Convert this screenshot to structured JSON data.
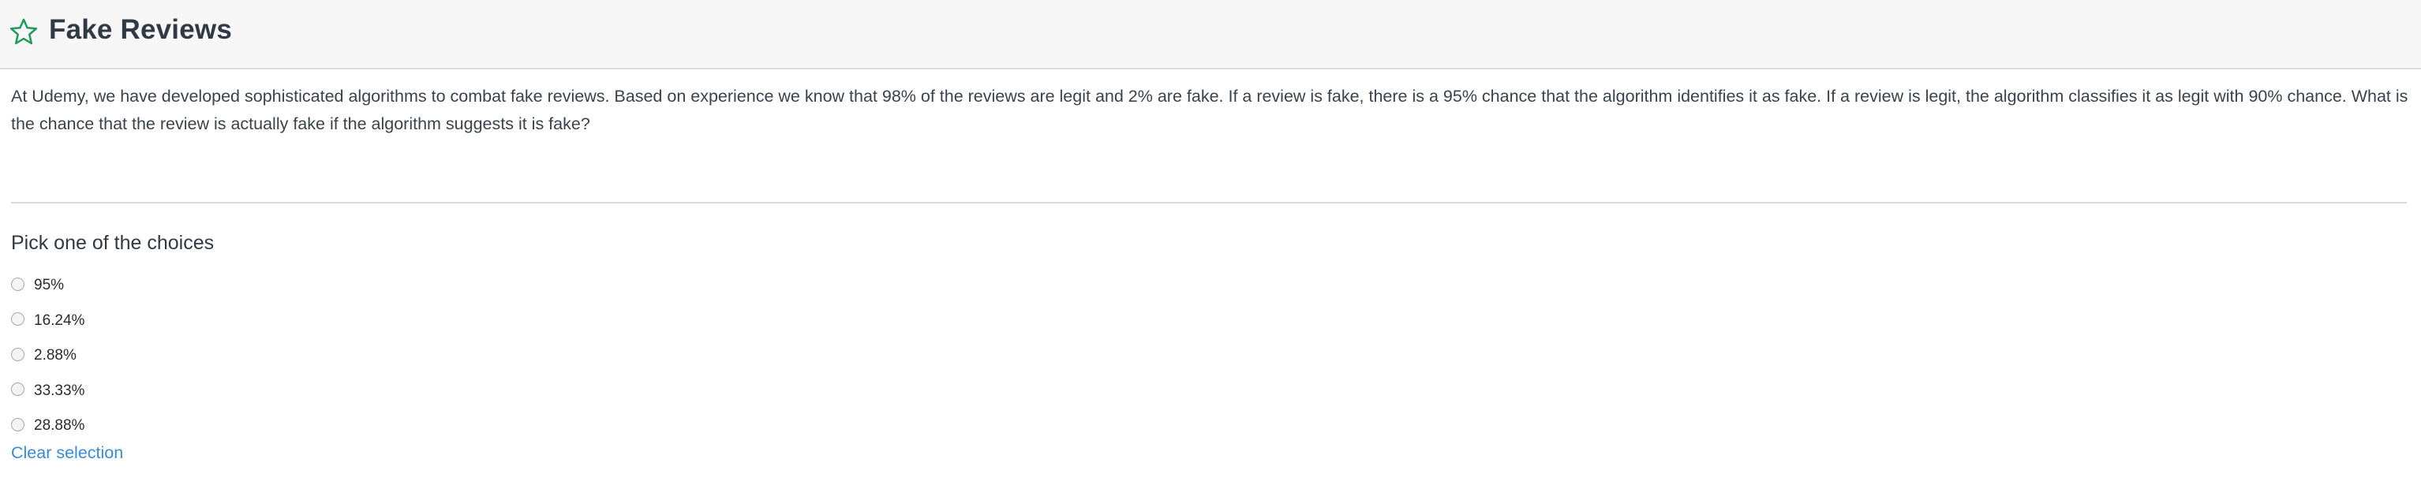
{
  "header": {
    "title": "Fake Reviews",
    "icon": "star-outline-icon",
    "icon_color": "#1e9c5a"
  },
  "question": {
    "text": "At Udemy, we have developed sophisticated algorithms to combat fake reviews. Based on experience we know that 98% of the reviews are legit and 2% are fake. If a review is fake, there is a 95% chance that the algorithm identifies it as fake. If a review is legit, the algorithm classifies it as legit with 90% chance. What is the chance that the review is actually fake if the algorithm suggests it is fake?"
  },
  "answer": {
    "prompt": "Pick one of the choices",
    "choices": [
      {
        "label": "95%"
      },
      {
        "label": "16.24%"
      },
      {
        "label": "2.88%"
      },
      {
        "label": "33.33%"
      },
      {
        "label": "28.88%"
      }
    ],
    "clear_label": "Clear selection",
    "link_color": "#3b8ad9"
  }
}
